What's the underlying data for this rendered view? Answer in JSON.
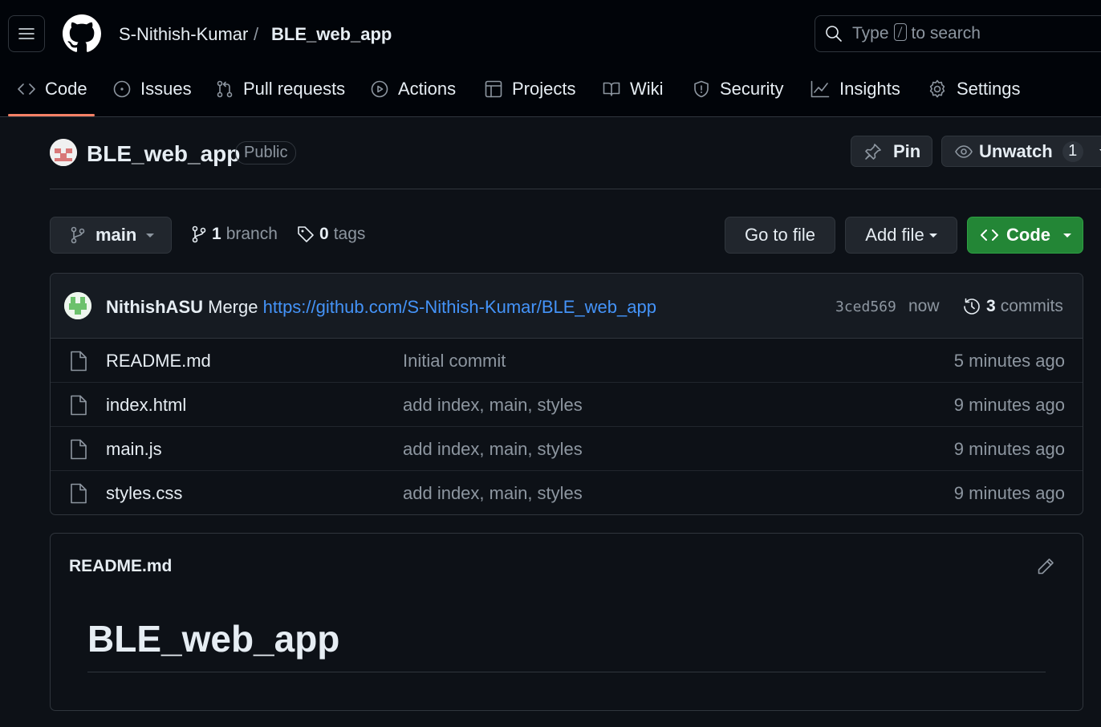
{
  "header": {
    "owner": "S-Nithish-Kumar",
    "separator": "/",
    "repo": "BLE_web_app",
    "search": {
      "before": "Type",
      "after": "to search"
    }
  },
  "tabs": [
    {
      "label": "Code",
      "icon": "code-icon",
      "selected": true
    },
    {
      "label": "Issues",
      "icon": "issue-opened-icon"
    },
    {
      "label": "Pull requests",
      "icon": "git-pull-request-icon"
    },
    {
      "label": "Actions",
      "icon": "play-icon"
    },
    {
      "label": "Projects",
      "icon": "table-icon"
    },
    {
      "label": "Wiki",
      "icon": "book-icon"
    },
    {
      "label": "Security",
      "icon": "shield-icon"
    },
    {
      "label": "Insights",
      "icon": "graph-icon"
    },
    {
      "label": "Settings",
      "icon": "gear-icon"
    }
  ],
  "repo_header": {
    "title": "BLE_web_app",
    "visibility": "Public",
    "pin_label": "Pin",
    "watch_label": "Unwatch",
    "watch_count": "1"
  },
  "branch_bar": {
    "branch": "main",
    "branch_count": "1",
    "branch_word": "branch",
    "tag_count": "0",
    "tag_word": "tags",
    "go_to_file": "Go to file",
    "add_file": "Add file",
    "code": "Code"
  },
  "latest_commit": {
    "author": "NithishASU",
    "message_prefix": "Merge",
    "message_link": "https://github.com/S-Nithish-Kumar/BLE_web_app",
    "sha": "3ced569",
    "time": "now",
    "commit_count": "3",
    "commit_word": "commits"
  },
  "files": [
    {
      "name": "README.md",
      "message": "Initial commit",
      "age": "5 minutes ago"
    },
    {
      "name": "index.html",
      "message": "add index, main, styles",
      "age": "9 minutes ago"
    },
    {
      "name": "main.js",
      "message": "add index, main, styles",
      "age": "9 minutes ago"
    },
    {
      "name": "styles.css",
      "message": "add index, main, styles",
      "age": "9 minutes ago"
    }
  ],
  "readme": {
    "title": "README.md",
    "heading": "BLE_web_app"
  },
  "colors": {
    "background": "#0d1117",
    "header_background": "#010409",
    "accent_underline": "#f78166",
    "link": "#4493f8",
    "primary_button": "#238636"
  }
}
